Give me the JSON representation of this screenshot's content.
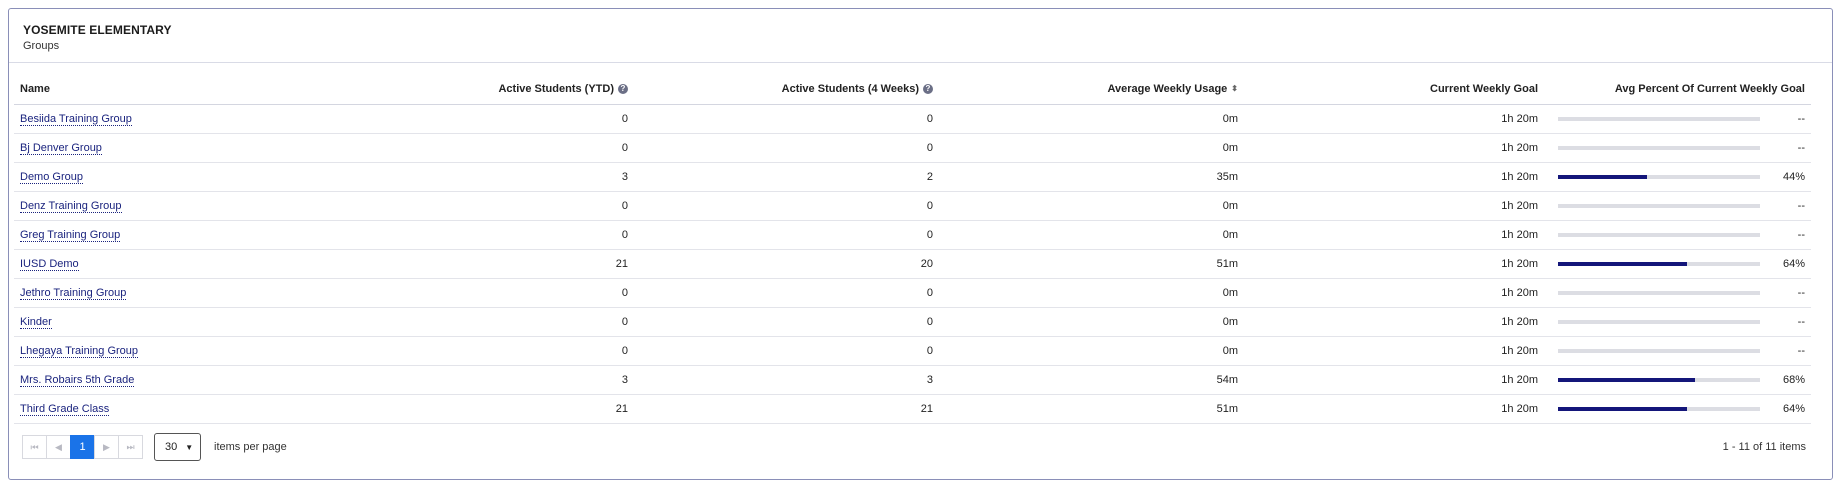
{
  "header": {
    "school": "YOSEMITE ELEMENTARY",
    "subtitle": "Groups"
  },
  "columns": {
    "name": "Name",
    "active_ytd": "Active Students (YTD)",
    "active_4wk": "Active Students (4 Weeks)",
    "avg_usage": "Average Weekly Usage",
    "goal": "Current Weekly Goal",
    "avg_pct": "Avg Percent Of Current Weekly Goal"
  },
  "icons": {
    "help": "question-circle-icon",
    "sort": "sort-icon"
  },
  "colors": {
    "bar_fill": "#14167a",
    "bar_track": "#dcdde3",
    "link": "#1a237e",
    "active_page": "#1a73e8"
  },
  "rows": [
    {
      "name": "Besiida Training Group",
      "ytd": "0",
      "wk4": "0",
      "usage": "0m",
      "goal": "1h 20m",
      "pct": 0,
      "pct_label": "--"
    },
    {
      "name": "Bj Denver Group",
      "ytd": "0",
      "wk4": "0",
      "usage": "0m",
      "goal": "1h 20m",
      "pct": 0,
      "pct_label": "--"
    },
    {
      "name": "Demo Group",
      "ytd": "3",
      "wk4": "2",
      "usage": "35m",
      "goal": "1h 20m",
      "pct": 44,
      "pct_label": "44%"
    },
    {
      "name": "Denz Training Group",
      "ytd": "0",
      "wk4": "0",
      "usage": "0m",
      "goal": "1h 20m",
      "pct": 0,
      "pct_label": "--"
    },
    {
      "name": "Greg Training Group",
      "ytd": "0",
      "wk4": "0",
      "usage": "0m",
      "goal": "1h 20m",
      "pct": 0,
      "pct_label": "--"
    },
    {
      "name": "IUSD Demo",
      "ytd": "21",
      "wk4": "20",
      "usage": "51m",
      "goal": "1h 20m",
      "pct": 64,
      "pct_label": "64%"
    },
    {
      "name": "Jethro Training Group",
      "ytd": "0",
      "wk4": "0",
      "usage": "0m",
      "goal": "1h 20m",
      "pct": 0,
      "pct_label": "--"
    },
    {
      "name": "Kinder",
      "ytd": "0",
      "wk4": "0",
      "usage": "0m",
      "goal": "1h 20m",
      "pct": 0,
      "pct_label": "--"
    },
    {
      "name": "Lhegaya Training Group",
      "ytd": "0",
      "wk4": "0",
      "usage": "0m",
      "goal": "1h 20m",
      "pct": 0,
      "pct_label": "--"
    },
    {
      "name": "Mrs. Robairs 5th Grade",
      "ytd": "3",
      "wk4": "3",
      "usage": "54m",
      "goal": "1h 20m",
      "pct": 68,
      "pct_label": "68%"
    },
    {
      "name": "Third Grade Class",
      "ytd": "21",
      "wk4": "21",
      "usage": "51m",
      "goal": "1h 20m",
      "pct": 64,
      "pct_label": "64%"
    }
  ],
  "pager": {
    "first": "⏮",
    "prev": "◀",
    "current": "1",
    "next": "▶",
    "last": "⏭",
    "per_page": "30",
    "per_page_label": "items per page",
    "range": "1 - 11 of 11 items"
  }
}
